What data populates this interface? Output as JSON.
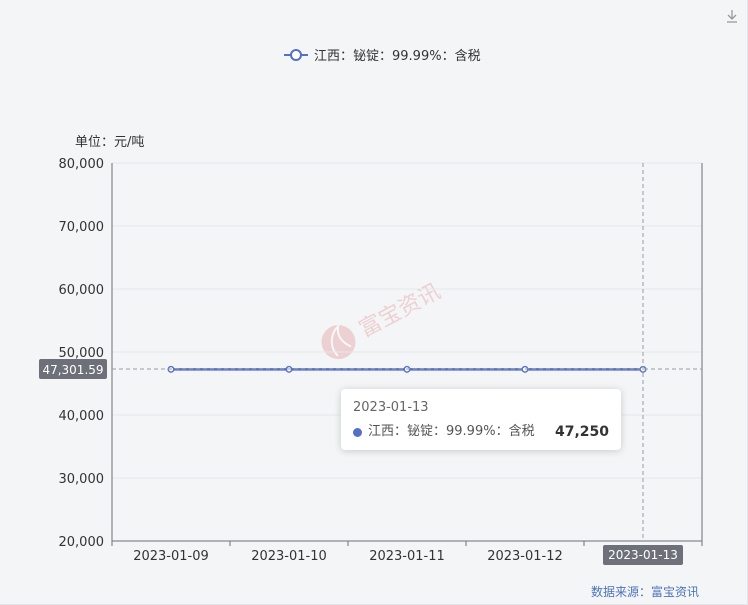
{
  "chart_data": {
    "type": "line",
    "legend": {
      "label": "江西：铋锭：99.99%：含税",
      "position": "top-center"
    },
    "unit_label": "单位：元/吨",
    "categories": [
      "2023-01-09",
      "2023-01-10",
      "2023-01-11",
      "2023-01-12",
      "2023-01-13"
    ],
    "series": [
      {
        "name": "江西：铋锭：99.99%：含税",
        "values": [
          47250,
          47250,
          47250,
          47250,
          47250
        ],
        "color": "#5470c6"
      }
    ],
    "ylim": [
      20000,
      80000
    ],
    "yticks": [
      "20,000",
      "30,000",
      "40,000",
      "50,000",
      "60,000",
      "70,000",
      "80,000"
    ],
    "ytick_values": [
      20000,
      30000,
      40000,
      50000,
      60000,
      70000,
      80000
    ],
    "grid": true,
    "crosshair": {
      "y_label": "47,301.59",
      "y_value": 47301.59,
      "x_label": "2023-01-13",
      "x_index": 4
    },
    "tooltip": {
      "date": "2023-01-13",
      "series": "江西：铋锭：99.99%：含税",
      "value": "47,250"
    },
    "watermark": "富宝资讯"
  },
  "footer": {
    "source_label": "数据来源：",
    "source_name": "富宝资讯"
  },
  "colors": {
    "line": "#5470c6",
    "grid": "#e6e8ec",
    "axis": "#6e7079",
    "crosshair_label_bg": "#6e7079",
    "source": "#4a74b8"
  },
  "icons": {
    "download": "download-icon"
  }
}
